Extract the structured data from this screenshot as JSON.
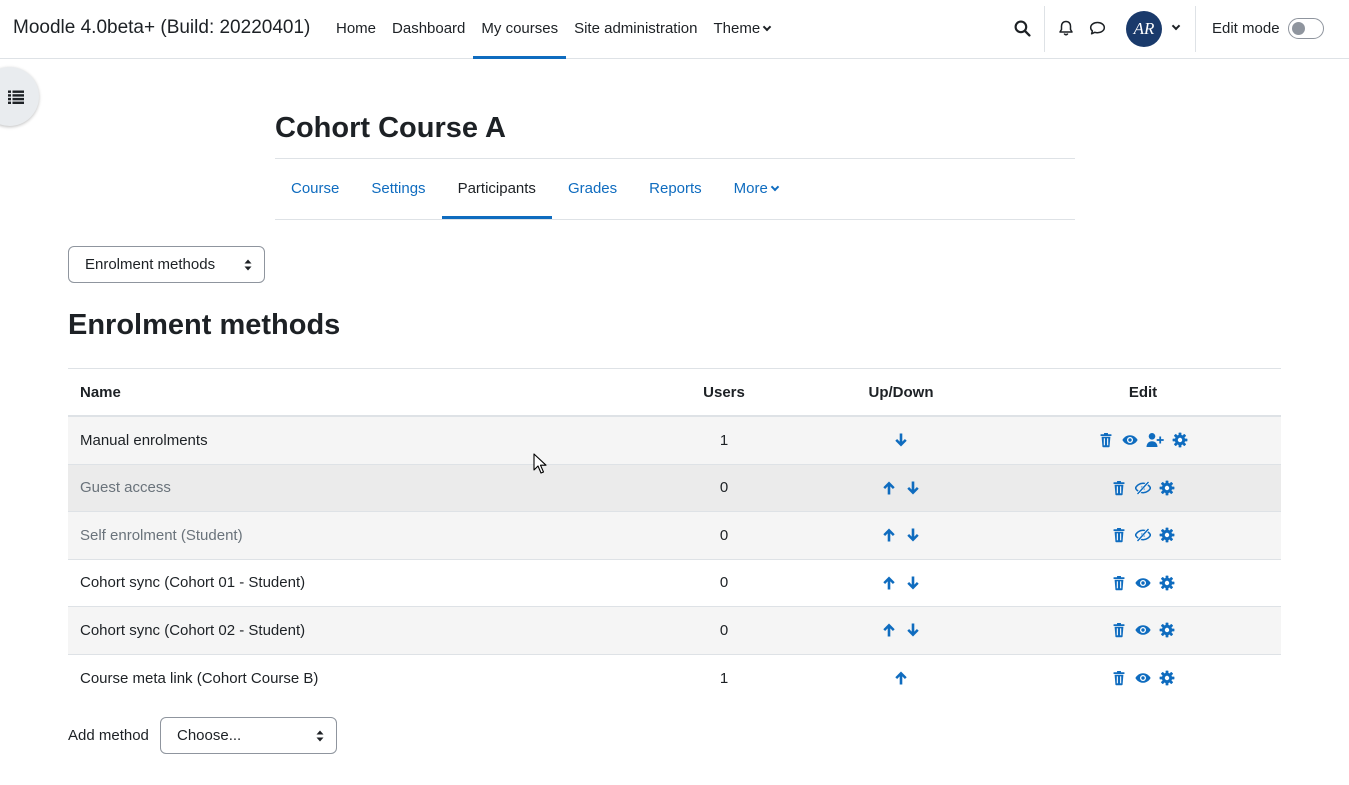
{
  "navbar": {
    "brand": "Moodle 4.0beta+ (Build: 20220401)",
    "items": [
      {
        "label": "Home"
      },
      {
        "label": "Dashboard"
      },
      {
        "label": "My courses",
        "active": true
      },
      {
        "label": "Site administration"
      },
      {
        "label": "Theme",
        "dropdown": true
      }
    ],
    "icons": [
      "search-icon",
      "bell-icon",
      "chat-bubble-icon"
    ],
    "avatar_initials": "AR",
    "edit_mode_label": "Edit mode",
    "edit_mode_on": false
  },
  "course": {
    "title": "Cohort Course A",
    "tabs": [
      {
        "label": "Course"
      },
      {
        "label": "Settings"
      },
      {
        "label": "Participants",
        "active": true
      },
      {
        "label": "Grades"
      },
      {
        "label": "Reports"
      },
      {
        "label": "More",
        "dropdown": true
      }
    ]
  },
  "jump_select": {
    "value": "Enrolment methods"
  },
  "page": {
    "heading": "Enrolment methods"
  },
  "table": {
    "headers": {
      "name": "Name",
      "users": "Users",
      "updown": "Up/Down",
      "edit": "Edit"
    },
    "rows": [
      {
        "name": "Manual enrolments",
        "users": "1",
        "dimmed": false,
        "up": false,
        "down": true,
        "enabled": true,
        "enrol_users": true
      },
      {
        "name": "Guest access",
        "users": "0",
        "dimmed": true,
        "up": true,
        "down": true,
        "enabled": false,
        "enrol_users": false
      },
      {
        "name": "Self enrolment (Student)",
        "users": "0",
        "dimmed": true,
        "up": true,
        "down": true,
        "enabled": false,
        "enrol_users": false
      },
      {
        "name": "Cohort sync (Cohort 01 - Student)",
        "users": "0",
        "dimmed": false,
        "up": true,
        "down": true,
        "enabled": true,
        "enrol_users": false
      },
      {
        "name": "Cohort sync (Cohort 02 - Student)",
        "users": "0",
        "dimmed": false,
        "up": true,
        "down": true,
        "enabled": true,
        "enrol_users": false
      },
      {
        "name": "Course meta link (Cohort Course B)",
        "users": "1",
        "dimmed": false,
        "up": true,
        "down": false,
        "enabled": true,
        "enrol_users": false
      }
    ]
  },
  "add_method": {
    "label": "Add method",
    "placeholder": "Choose..."
  },
  "colors": {
    "primary": "#0f6cbf",
    "text": "#1d2125",
    "muted": "#6a737b",
    "border": "#dee2e6"
  }
}
